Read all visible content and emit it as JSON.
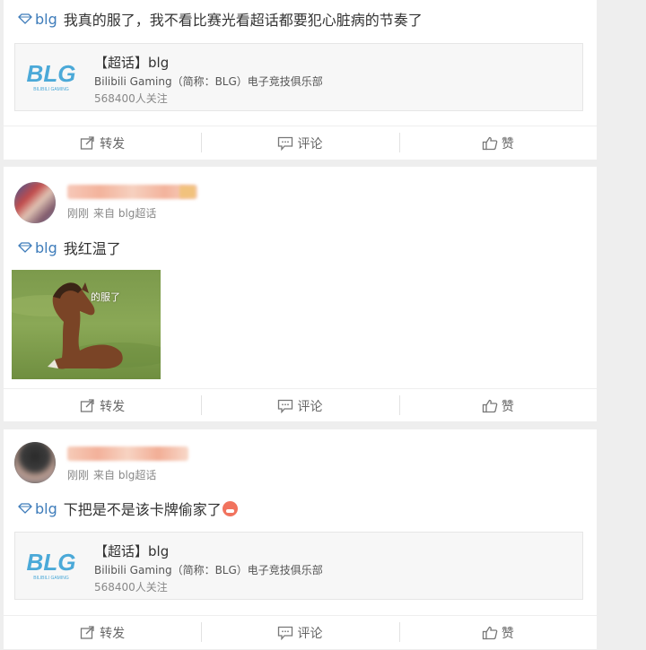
{
  "topic_card": {
    "logo_text": "BLG",
    "logo_subtext": "BILIBILI GAMING",
    "title": "【超话】blg",
    "description": "Bilibili Gaming（简称：BLG）电子竞技俱乐部",
    "followers": "568400人关注"
  },
  "actions": {
    "repost": "转发",
    "comment": "评论",
    "like": "赞"
  },
  "posts": [
    {
      "tag": "blg",
      "text": "我真的服了，我不看比赛光看超话都要犯心脏病的节奏了"
    },
    {
      "time": "刚刚",
      "source": "来自 blg超话",
      "tag": "blg",
      "text": "我红温了",
      "image_caption": "的服了"
    },
    {
      "time": "刚刚",
      "source": "来自 blg超话",
      "tag": "blg",
      "text": "下把是不是该卡牌偷家了"
    }
  ],
  "colors": {
    "link": "#3e7cba",
    "logo_blue": "#4ba9d8",
    "background": "#eeeeee"
  },
  "icons": [
    "diamond-tag-icon",
    "repost-icon",
    "comment-icon",
    "like-icon",
    "emoji-icon"
  ]
}
